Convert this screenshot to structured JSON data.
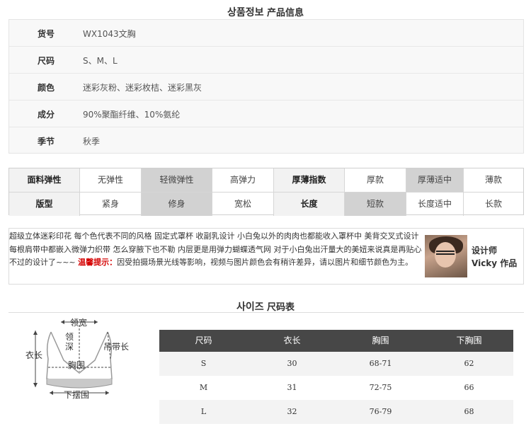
{
  "product_info": {
    "title_kr": "상품정보",
    "title_cn": "产品信息",
    "rows": [
      {
        "label": "货号",
        "value": "WX1043文胸"
      },
      {
        "label": "尺码",
        "value": "S、M、L"
      },
      {
        "label": "颜色",
        "value": "迷彩灰粉、迷彩枚桔、迷彩黑灰"
      },
      {
        "label": "成分",
        "value": "90%聚酯纤维、10%氨纶"
      },
      {
        "label": "季节",
        "value": "秋季"
      }
    ]
  },
  "attributes": {
    "row1": [
      "面料弹性",
      "无弹性",
      "轻微弹性",
      "高弹力",
      "厚薄指数",
      "厚款",
      "厚薄适中",
      "薄款"
    ],
    "row2": [
      "版型",
      "紧身",
      "修身",
      "宽松",
      "长度",
      "短款",
      "长度适中",
      "长款"
    ],
    "row1_selected": [
      2,
      6
    ],
    "row2_selected": [
      2,
      5
    ]
  },
  "description": {
    "text_main": "超级立体迷彩印花 每个色代表不同的风格 固定式罩杯 收副乳设计 小白兔以外的肉肉也都能收入罩杯中 美背交叉式设计 每根肩带中都嵌入微弹力织带 怎么穿腋下也不勒 内层更是用弹力蝴蝶透气网 对于小白兔出汗量大的美妞来说真是再贴心不过的设计了~~~ ",
    "warning_label": "温馨提示：",
    "text_note": "因受拍摄场景光线等影响，视频与图片颜色会有稍许差异，请以图片和细节颜色为主。",
    "designer_line1": "设计师",
    "designer_line2": "Vicky 作品"
  },
  "size_section": {
    "title_kr": "사이즈",
    "title_cn": "尺码表"
  },
  "diagram": {
    "labels": {
      "neck_width": "领宽",
      "neck_depth": "领深",
      "strap_length": "吊带长",
      "body_length": "衣长",
      "chest": "胸围",
      "hem": "下摆围"
    }
  },
  "size_table": {
    "headers": [
      "尺码",
      "衣长",
      "胸围",
      "下胸围"
    ],
    "rows": [
      [
        "S",
        "30",
        "68-71",
        "62"
      ],
      [
        "M",
        "31",
        "72-75",
        "66"
      ],
      [
        "L",
        "32",
        "76-79",
        "68"
      ]
    ]
  },
  "colors": {
    "table_header_bg": "#474747",
    "selected_cell_bg": "#d2d2d2",
    "warning_text": "#d40000"
  }
}
